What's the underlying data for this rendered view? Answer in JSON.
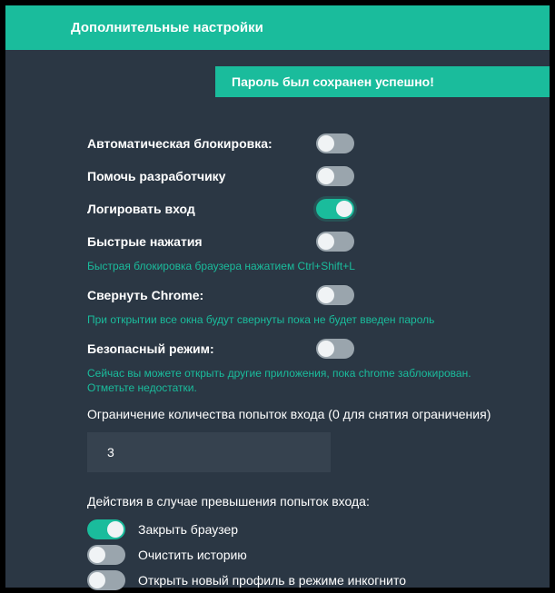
{
  "header": {
    "title": "Дополнительные настройки"
  },
  "banner": {
    "message": "Пароль был сохранен успешно!"
  },
  "settings": {
    "auto_lock": {
      "label": "Автоматическая блокировка:",
      "enabled": false
    },
    "help_dev": {
      "label": "Помочь разработчику",
      "enabled": false
    },
    "log_login": {
      "label": "Логировать вход",
      "enabled": true
    },
    "quick_press": {
      "label": "Быстрые нажатия",
      "enabled": false,
      "hint": "Быстрая блокировка браузера нажатием Ctrl+Shift+L"
    },
    "minimize_chrome": {
      "label": "Свернуть Chrome:",
      "enabled": false,
      "hint": "При открытии все окна будут свернуты пока не будет введен пароль"
    },
    "safe_mode": {
      "label": "Безопасный режим:",
      "enabled": false,
      "hint": "Сейчас вы можете открыть другие приложения, пока chrome заблокирован. Отметьте недостатки."
    }
  },
  "limit": {
    "label": "Ограничение количества попыток входа (0 для снятия ограничения)",
    "value": "3"
  },
  "actions": {
    "label": "Действия в случае превышения попыток входа:",
    "close_browser": {
      "label": "Закрыть браузер",
      "enabled": true
    },
    "clear_history": {
      "label": "Очистить историю",
      "enabled": false
    },
    "incognito": {
      "label": "Открыть новый профиль в режиме инкогнито",
      "enabled": false
    }
  }
}
